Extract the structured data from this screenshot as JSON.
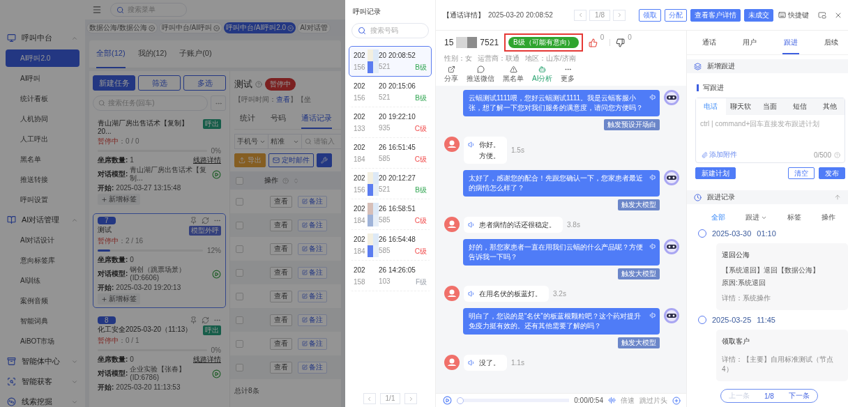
{
  "sidebar": {
    "groups": [
      {
        "label": "呼叫中台",
        "expanded": true,
        "items": [
          {
            "label": "AI呼叫2.0",
            "selected": true
          },
          {
            "label": "AI呼叫",
            "selected": false
          },
          {
            "label": "统计看板",
            "selected": false
          },
          {
            "label": "人机协同",
            "selected": false
          },
          {
            "label": "人工呼出",
            "selected": false
          },
          {
            "label": "黑名单",
            "selected": false
          },
          {
            "label": "推送转接",
            "selected": false
          },
          {
            "label": "呼叫设置",
            "selected": false
          }
        ]
      },
      {
        "label": "AI对话管理",
        "expanded": true,
        "items": [
          {
            "label": "AI对话设计",
            "selected": false
          },
          {
            "label": "意向标签库",
            "selected": false
          },
          {
            "label": "AI训练",
            "selected": false
          },
          {
            "label": "案例音频",
            "selected": false
          },
          {
            "label": "智能词典",
            "selected": false
          },
          {
            "label": "AiBOT市场",
            "selected": false
          }
        ]
      },
      {
        "label": "智能体中心",
        "expanded": false
      },
      {
        "label": "智能获客",
        "expanded": false
      },
      {
        "label": "线索挖掘",
        "expanded": false
      }
    ]
  },
  "topbar": {
    "search_placeholder": "搜索菜单"
  },
  "page_tabs": [
    {
      "label": "数据公海/数据公海",
      "selected": false,
      "closable": true
    },
    {
      "label": "呼叫中台/AI呼叫",
      "selected": false,
      "closable": true
    },
    {
      "label": "呼叫中台/AI呼叫2.0",
      "selected": true,
      "closable": true
    },
    {
      "label": "AI对话管",
      "selected": false,
      "closable": false
    }
  ],
  "view_tabs": [
    {
      "label": "全部(12)",
      "selected": true
    },
    {
      "label": "我的(12)",
      "selected": false
    },
    {
      "label": "子账户(0)",
      "selected": false
    }
  ],
  "tasks": {
    "buttons": [
      {
        "label": "新建任务",
        "kind": "filled"
      },
      {
        "label": "筛选",
        "kind": "outline"
      },
      {
        "label": "多选",
        "kind": "outline"
      }
    ],
    "search_placeholder": "搜索任务(回车)",
    "cards": [
      {
        "title": "青山湖厂房出售话术【复制】20...",
        "tag": {
          "label": "呼出",
          "kind": "outbound"
        },
        "status": "暂停中",
        "count": "：0 / 0",
        "level": 0,
        "percent": "0%",
        "selected": false,
        "fields": [
          {
            "label": "坐席数量:",
            "value": "1",
            "link": "线路详情"
          },
          {
            "label": "对话模型:",
            "value": "青山湖厂房出售话术【复制..."
          },
          {
            "label": "开始:",
            "value": "2025-03-27 13:15:48"
          }
        ],
        "add_tag": "新增标签"
      },
      {
        "number": "7",
        "title": "测试",
        "tag": {
          "label": "模型外呼",
          "kind": "model"
        },
        "status": "暂停中",
        "count": "：2 / 16",
        "level": 0.12,
        "percent": "12%",
        "selected": true,
        "fields": [
          {
            "label": "坐席数量:",
            "value": "0"
          },
          {
            "label": "对话模型:",
            "value": "钢创（跳票场景）(ID:6606)"
          },
          {
            "label": "开始:",
            "value": "2025-03-20 19:20:13"
          }
        ],
        "add_tag": "新增标签"
      },
      {
        "number": "8",
        "title": "化工安全2025-03-20（11:13）",
        "tag": {
          "label": "呼出",
          "kind": "outbound"
        },
        "status": "暂停中",
        "count": "：0 / 1",
        "level": 0,
        "percent": "0%",
        "selected": false,
        "fields": [
          {
            "label": "坐席数量:",
            "value": "0",
            "link": "线路详情"
          },
          {
            "label": "对话模型:",
            "value": "企业实验【张春】(ID:6786)"
          },
          {
            "label": "开始:",
            "value": "2025-03-20 11:13:53"
          }
        ]
      }
    ]
  },
  "detail": {
    "title": "测试",
    "status": "暂停中",
    "meta_prefix": "【呼叫时间：",
    "meta_link": "查看",
    "meta_suffix": "】【坐",
    "tabs": [
      {
        "label": "统计",
        "selected": false
      },
      {
        "label": "号码",
        "selected": false
      },
      {
        "label": "通话记录",
        "selected": true
      }
    ],
    "filters": [
      "手机号",
      "精准"
    ],
    "search_placeholder": "请输入",
    "export": "导出",
    "mail": "定时邮件",
    "column": "操作",
    "select_all_checked": false,
    "rows": [
      {
        "view": "查看",
        "note": "备注",
        "checked": false
      },
      {
        "view": "查看",
        "note": "备注",
        "checked": false
      },
      {
        "view": "查看",
        "note": "备注",
        "checked": false
      },
      {
        "view": "查看",
        "note": "备注",
        "checked": false
      },
      {
        "view": "查看",
        "note": "备注",
        "checked": false
      },
      {
        "view": "查看",
        "note": "备注",
        "checked": false
      },
      {
        "view": "查看",
        "note": "备注",
        "checked": false
      },
      {
        "view": "查看",
        "note": "备注",
        "checked": false
      }
    ],
    "total": "总计8条"
  },
  "call_list": {
    "title": "呼叫记录",
    "search_placeholder": "搜索号码",
    "page": "1/1",
    "items": [
      {
        "time_start": "202",
        "time_end": "20 20:08:52",
        "phone_start": "156",
        "phone_end": "521",
        "grade": "B级",
        "kind": "good",
        "selected": true,
        "redacted": true
      },
      {
        "time_start": "202",
        "time_end": "20 20:15:06",
        "phone_start": "156",
        "phone_end": "521",
        "grade": "B级",
        "kind": "good",
        "selected": false,
        "redacted": false
      },
      {
        "time_start": "202",
        "time_end": "20 19:22:10",
        "phone_start": "133",
        "phone_end": "935",
        "grade": "C级",
        "kind": "poor",
        "selected": false,
        "redacted": false
      },
      {
        "time_start": "202",
        "time_end": "26 16:51:45",
        "phone_start": "184",
        "phone_end": "585",
        "grade": "C级",
        "kind": "poor",
        "selected": false,
        "redacted": false
      },
      {
        "time_start": "202",
        "time_end": "20 20:12:27",
        "phone_start": "156",
        "phone_end": "521",
        "grade": "B级",
        "kind": "good",
        "selected": false,
        "redacted": true
      },
      {
        "time_start": "202",
        "time_end": "26 16:58:51",
        "phone_start": "184",
        "phone_end": "585",
        "grade": "C级",
        "kind": "poor",
        "selected": false,
        "redacted": true
      },
      {
        "time_start": "202",
        "time_end": "26 16:54:48",
        "phone_start": "184",
        "phone_end": "585",
        "grade": "C级",
        "kind": "poor",
        "selected": false,
        "redacted": true
      },
      {
        "time_start": "202",
        "time_end": "26 14:26:05",
        "phone_start": "158",
        "phone_end": "103",
        "grade": "F级",
        "kind": "none",
        "selected": false,
        "redacted": false
      }
    ]
  },
  "call_header": {
    "title": "【通话详情】",
    "time": "2025-03-20 20:08:52",
    "page": "1/8",
    "buttons": [
      {
        "label": "领取",
        "kind": "outline"
      },
      {
        "label": "分配",
        "kind": "outline"
      },
      {
        "label": "查看客户详情",
        "kind": "filled"
      },
      {
        "label": "未成交",
        "kind": "filled"
      }
    ],
    "shortcut": "快捷键"
  },
  "customer": {
    "phone_start": "15",
    "phone_end": "7521",
    "grade": "B级（可能有意向）",
    "highlighted": true,
    "likes": "0",
    "dislikes": "0",
    "info": [
      "性别：女",
      "运营商：联通",
      "地区：山东/济南"
    ],
    "actions": [
      {
        "label": "分享",
        "selected": false
      },
      {
        "label": "推送微信",
        "selected": false
      },
      {
        "label": "黑名单",
        "selected": false
      },
      {
        "label": "AI分析",
        "selected": true
      },
      {
        "label": "更多",
        "selected": false
      }
    ]
  },
  "messages": [
    {
      "kind": "bot",
      "text": "云蝠测试1111喂，您好云蝠测试1111。我是云蝠客服小张，想了解一下您对我们服务的满意度，请问您方便吗？",
      "trigger": "触发预设开场白"
    },
    {
      "kind": "user",
      "lines": [
        "你好。",
        "方便。"
      ],
      "duration": "1.5s"
    },
    {
      "kind": "bot",
      "text": "太好了，感谢您的配合！先跟您确认一下，您家患者最近的病情怎么样了？",
      "trigger": "触发大模型"
    },
    {
      "kind": "user",
      "lines": [
        "患者病情的话还很稳定。"
      ],
      "duration": "3.8s"
    },
    {
      "kind": "bot",
      "text": "好的，那您家患者一直在用我们云蝠的什么产品呢？方便告诉我一下吗？",
      "trigger": "触发大模型"
    },
    {
      "kind": "user",
      "lines": [
        "在用名伏的板蓝灯。"
      ],
      "duration": "3.2s"
    },
    {
      "kind": "bot",
      "text": "明白了，您说的是“名伏”的板蓝根颗粒吧？这个药对提升免疫力挺有效的。还有其他需要了解的吗？",
      "trigger": "触发大模型"
    },
    {
      "kind": "user",
      "lines": [
        "没了。"
      ],
      "duration": "1.1s"
    }
  ],
  "player": {
    "time": "0:00/0:54",
    "speed": "倍速",
    "skip": "跳过片头",
    "level": 0
  },
  "panel": {
    "tabs": [
      {
        "label": "通话",
        "selected": false
      },
      {
        "label": "用户",
        "selected": false
      },
      {
        "label": "跟进",
        "selected": true
      },
      {
        "label": "后续",
        "selected": false
      }
    ],
    "new_section": "新增跟进",
    "write_label": "写跟进",
    "channels": [
      {
        "label": "电话",
        "selected": true
      },
      {
        "label": "聊天软",
        "selected": false
      },
      {
        "label": "当面",
        "selected": false
      },
      {
        "label": "短信",
        "selected": false
      },
      {
        "label": "其他",
        "selected": false
      }
    ],
    "placeholder": "ctrl | command+回车直接发布跟进计划",
    "attach": "添加附件",
    "counter": "0/500",
    "plan": "新建计划",
    "clear": "清空",
    "publish": "发布",
    "records_title": "跟进记录",
    "filters": [
      {
        "label": "全部",
        "selected": true,
        "dropdown": false
      },
      {
        "label": "跟进",
        "selected": false,
        "dropdown": true
      },
      {
        "label": "标签",
        "selected": false,
        "dropdown": false
      },
      {
        "label": "操作",
        "selected": false,
        "dropdown": false
      }
    ],
    "timeline": [
      {
        "date": "2025-03-30",
        "time": "01:10",
        "title": "退回公海",
        "lines": [
          "【系统退回】退回【数据公海】",
          "原因:系统退回"
        ],
        "detail": "详情：系统操作"
      },
      {
        "date": "2025-03-25",
        "time": "11:45",
        "title": "领取客户",
        "detail": "详情：【主要】自用标准测试（节点4）"
      }
    ],
    "pager": {
      "prev": "上一条",
      "prev_disabled": true,
      "page": "1/8",
      "next": "下一条"
    }
  }
}
